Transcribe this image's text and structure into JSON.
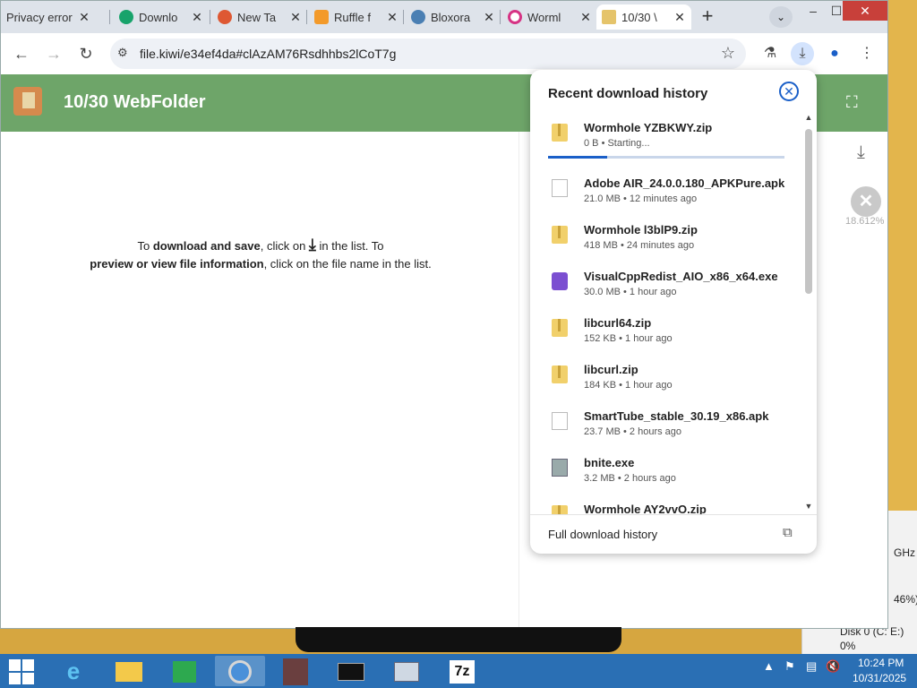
{
  "browser": {
    "tabs": [
      {
        "label": "Privacy error",
        "icon": "alert-icon"
      },
      {
        "label": "Downlo",
        "icon": "download-site-icon"
      },
      {
        "label": "New Ta",
        "icon": "duckduckgo-icon"
      },
      {
        "label": "Ruffle f",
        "icon": "ruffle-icon"
      },
      {
        "label": "Bloxora",
        "icon": "bloxorz-icon"
      },
      {
        "label": "Worml",
        "icon": "wormhole-icon"
      },
      {
        "label": "10/30 \\",
        "icon": "folder-icon"
      }
    ],
    "new_tab": "+",
    "tab_search": "⌄",
    "window_controls": {
      "minimize": "–",
      "maximize": "☐",
      "close": "✕"
    },
    "url": "file.kiwi/e34ef4da#clAzAM76Rsdhhbs2lCoT7g"
  },
  "page": {
    "title": "10/30 WebFolder",
    "info_line1_a": "To ",
    "info_line1_b": "download and save",
    "info_line1_c": ", click on ",
    "info_line1_d": " in the list. To",
    "info_line2_a": "preview or view file information",
    "info_line2_b": ", click on the file name in the list.",
    "side_percent": "18.612%"
  },
  "downloads": {
    "title": "Recent download history",
    "items": [
      {
        "name": "Wormhole YZBKWY.zip",
        "meta": "0 B • Starting...",
        "type": "zip",
        "progress": 0.25
      },
      {
        "name": "Adobe AIR_24.0.0.180_APKPure.apk",
        "meta": "21.0 MB • 12 minutes ago",
        "type": "doc"
      },
      {
        "name": "Wormhole l3blP9.zip",
        "meta": "418 MB • 24 minutes ago",
        "type": "zip"
      },
      {
        "name": "VisualCppRedist_AIO_x86_x64.exe",
        "meta": "30.0 MB • 1 hour ago",
        "type": "vs"
      },
      {
        "name": "libcurl64.zip",
        "meta": "152 KB • 1 hour ago",
        "type": "zip"
      },
      {
        "name": "libcurl.zip",
        "meta": "184 KB • 1 hour ago",
        "type": "zip"
      },
      {
        "name": "SmartTube_stable_30.19_x86.apk",
        "meta": "23.7 MB • 2 hours ago",
        "type": "doc"
      },
      {
        "name": "bnite.exe",
        "meta": "3.2 MB • 2 hours ago",
        "type": "exe"
      },
      {
        "name": "Wormhole AY2vvO.zip",
        "meta": "",
        "type": "zip"
      }
    ],
    "footer": "Full download history"
  },
  "desktop": {
    "ghz": "GHz",
    "pct": "46%)",
    "disk": "Disk 0 (C: E:)",
    "disk_pct": "0%"
  },
  "taskbar": {
    "time": "10:24 PM",
    "date": "10/31/2025",
    "apps": [
      "internet-explorer",
      "file-explorer",
      "store",
      "chrome",
      "app-figure",
      "cmd",
      "task-manager",
      "7zip"
    ]
  }
}
